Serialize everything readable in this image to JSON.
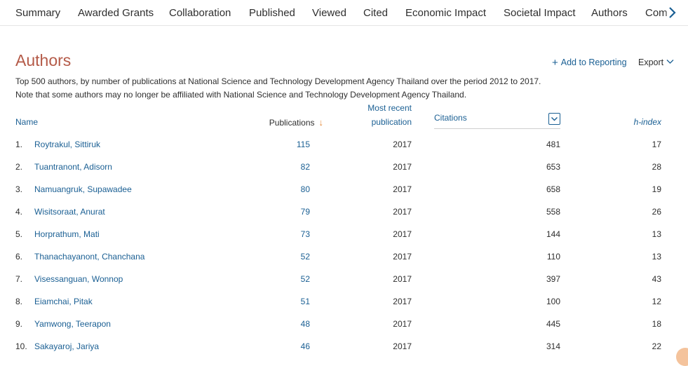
{
  "nav": {
    "tabs": [
      "Summary",
      "Awarded Grants",
      "Collaboration",
      "Published",
      "Viewed",
      "Cited",
      "Economic Impact",
      "Societal Impact",
      "Authors",
      "Com"
    ],
    "next_icon": "chevron-right-icon"
  },
  "header": {
    "title": "Authors",
    "add_reporting": "Add to Reporting",
    "export": "Export"
  },
  "description": {
    "line1": "Top 500 authors, by number of publications at National Science and Technology Development Agency Thailand over the period 2012 to 2017.",
    "line2": "Note that some authors may no longer be affiliated with National Science and Technology Development Agency Thailand."
  },
  "table": {
    "columns": {
      "name": "Name",
      "publications": "Publications",
      "most_recent_line1": "Most recent",
      "most_recent_line2": "publication",
      "citations": "Citations",
      "h_index": "h-index"
    },
    "rows": [
      {
        "rank": "1.",
        "name": "Roytrakul, Sittiruk",
        "publications": "115",
        "year": "2017",
        "citations": "481",
        "h_index": "17"
      },
      {
        "rank": "2.",
        "name": "Tuantranont, Adisorn",
        "publications": "82",
        "year": "2017",
        "citations": "653",
        "h_index": "28"
      },
      {
        "rank": "3.",
        "name": "Namuangruk, Supawadee",
        "publications": "80",
        "year": "2017",
        "citations": "658",
        "h_index": "19"
      },
      {
        "rank": "4.",
        "name": "Wisitsoraat, Anurat",
        "publications": "79",
        "year": "2017",
        "citations": "558",
        "h_index": "26"
      },
      {
        "rank": "5.",
        "name": "Horprathum, Mati",
        "publications": "73",
        "year": "2017",
        "citations": "144",
        "h_index": "13"
      },
      {
        "rank": "6.",
        "name": "Thanachayanont, Chanchana",
        "publications": "52",
        "year": "2017",
        "citations": "110",
        "h_index": "13"
      },
      {
        "rank": "7.",
        "name": "Visessanguan, Wonnop",
        "publications": "52",
        "year": "2017",
        "citations": "397",
        "h_index": "43"
      },
      {
        "rank": "8.",
        "name": "Eiamchai, Pitak",
        "publications": "51",
        "year": "2017",
        "citations": "100",
        "h_index": "12"
      },
      {
        "rank": "9.",
        "name": "Yamwong, Teerapon",
        "publications": "48",
        "year": "2017",
        "citations": "445",
        "h_index": "18"
      },
      {
        "rank": "10.",
        "name": "Sakayaroj, Jariya",
        "publications": "46",
        "year": "2017",
        "citations": "314",
        "h_index": "22"
      }
    ]
  },
  "colors": {
    "title": "#b45a48",
    "link": "#1a5f93",
    "sort_arrow": "#e58a3b"
  }
}
